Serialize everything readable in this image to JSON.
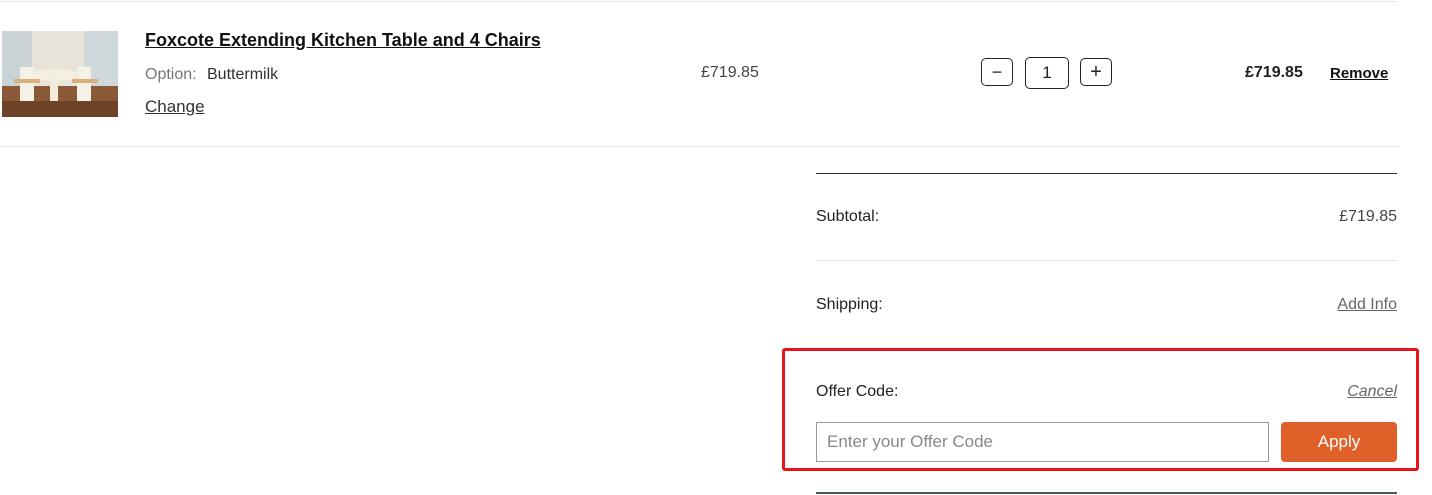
{
  "item": {
    "title": "Foxcote Extending Kitchen Table and 4 Chairs",
    "option_label": "Option:",
    "option_value": "Buttermilk",
    "change_label": "Change",
    "unit_price": "£719.85",
    "quantity": "1",
    "decrease_symbol": "−",
    "increase_symbol": "+",
    "line_total": "£719.85",
    "remove_label": "Remove",
    "image_icon": "product-photo-table-and-chairs"
  },
  "summary": {
    "subtotal_label": "Subtotal:",
    "subtotal_value": "£719.85",
    "shipping_label": "Shipping:",
    "shipping_action": "Add Info"
  },
  "offer": {
    "label": "Offer Code:",
    "cancel_label": "Cancel",
    "placeholder": "Enter your Offer Code",
    "value": "",
    "apply_label": "Apply"
  },
  "colors": {
    "accent": "#e0602a",
    "highlight_border": "#e8141d"
  }
}
